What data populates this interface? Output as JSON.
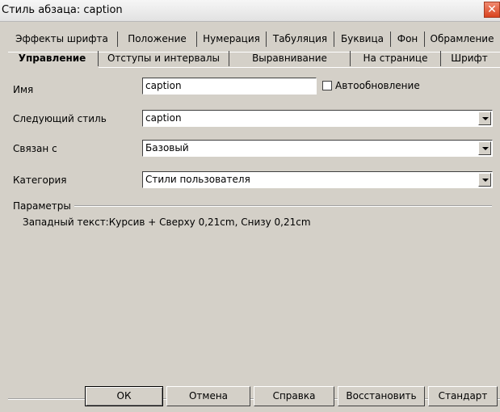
{
  "window": {
    "title": "Стиль абзаца: caption",
    "close_glyph": "✕"
  },
  "tabs_row1": [
    "Эффекты шрифта",
    "Положение",
    "Нумерация",
    "Табуляция",
    "Буквица",
    "Фон",
    "Обрамление"
  ],
  "tabs_row2": [
    "Управление",
    "Отступы и интервалы",
    "Выравнивание",
    "На странице",
    "Шрифт"
  ],
  "active_tab": "Управление",
  "form": {
    "name_label": "Имя",
    "name_value": "caption",
    "autoupdate_label": "Автообновление",
    "autoupdate_checked": false,
    "next_style_label": "Следующий стиль",
    "next_style_value": "caption",
    "linked_label": "Связан с",
    "linked_value": "Базовый",
    "category_label": "Категория",
    "category_value": "Стили пользователя"
  },
  "params": {
    "title": "Параметры",
    "text": "Западный текст:Курсив + Сверху 0,21cm, Снизу 0,21cm"
  },
  "buttons": {
    "ok": "ОК",
    "cancel": "Отмена",
    "help": "Справка",
    "reset": "Восстановить",
    "standard": "Стандарт"
  },
  "colors": {
    "dialog_bg": "#d4d0c8",
    "close_button": "#d9431f",
    "field_bg": "#ffffff"
  }
}
